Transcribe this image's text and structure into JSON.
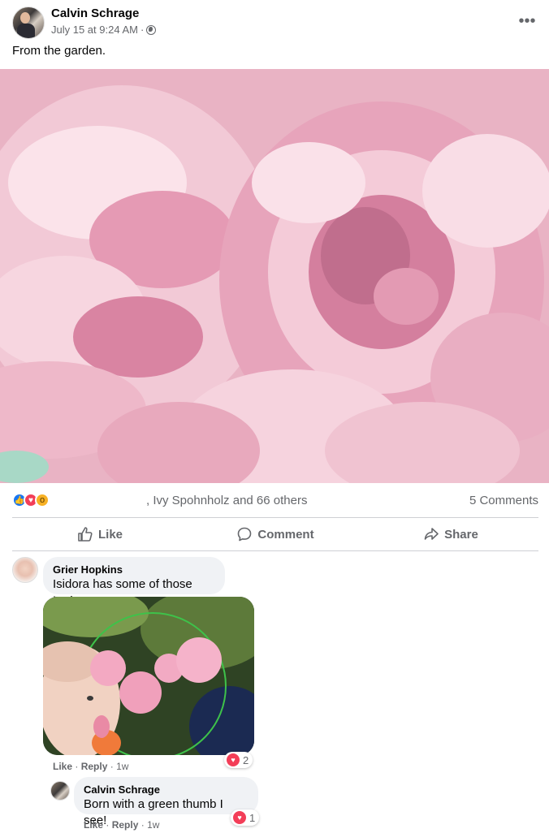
{
  "post": {
    "author": "Calvin Schrage",
    "timestamp": "July 15 at 9:24 AM",
    "separator": "·",
    "privacy_icon": "globe-icon",
    "more_label": "•••",
    "text": "From the garden."
  },
  "reactions": {
    "icons": [
      "like-icon",
      "love-icon",
      "wow-icon"
    ],
    "names": ", Ivy Spohnholz and 66 others",
    "comment_count": "5 Comments"
  },
  "actions": {
    "like": "Like",
    "comment": "Comment",
    "share": "Share"
  },
  "comments": [
    {
      "author": "Grier Hopkins",
      "text": "Isidora has some of those too!",
      "like": "Like",
      "reply": "Reply",
      "sep": "·",
      "age": "1w",
      "reaction_count": "2"
    },
    {
      "author": "Calvin Schrage",
      "text": "Born with a green thumb I see!",
      "like": "Like",
      "reply": "Reply",
      "sep": "·",
      "age": "1w",
      "reaction_count": "1"
    }
  ],
  "colors": {
    "facebook_blue": "#1877f2",
    "love_red": "#f33e58",
    "wow_yellow": "#f7b125",
    "secondary_text": "#65676b",
    "bubble_bg": "#f0f2f5"
  }
}
